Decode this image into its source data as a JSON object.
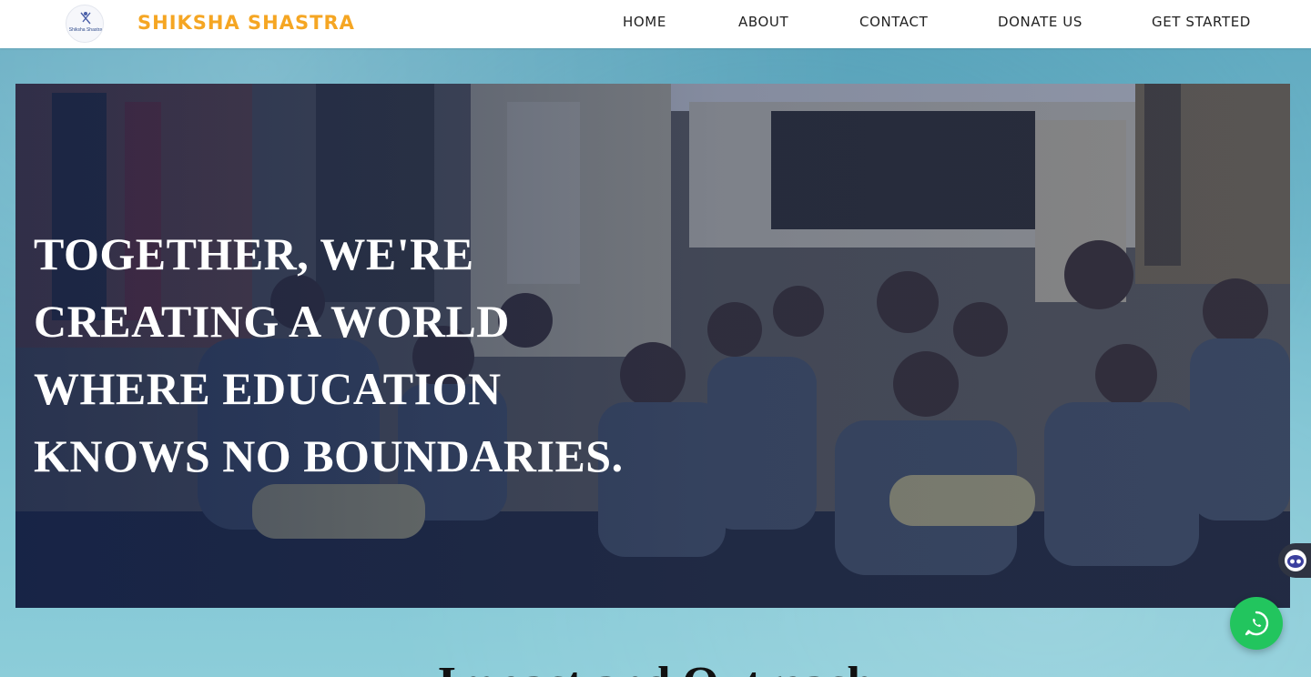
{
  "header": {
    "brand": "SHIKSHA SHASTRA",
    "logo_text": "Shiksha Shastra",
    "nav": {
      "home": "HOME",
      "about": "ABOUT",
      "contact": "CONTACT",
      "donate": "DONATE US",
      "get_started": "GET STARTED"
    }
  },
  "hero": {
    "headline_lines": [
      "TOGETHER, WE'RE",
      "CREATING A WORLD",
      "WHERE EDUCATION",
      "KNOWS NO BOUNDARIES."
    ]
  },
  "section": {
    "heading": "Impact and Outreach"
  },
  "widgets": {
    "chat_icon": "chatbot-icon",
    "whatsapp_icon": "whatsapp-icon"
  },
  "colors": {
    "brand": "#f5a623",
    "overlay": "#0e1e48",
    "whatsapp": "#22c55e",
    "page_bg": "#7cc2d2"
  }
}
